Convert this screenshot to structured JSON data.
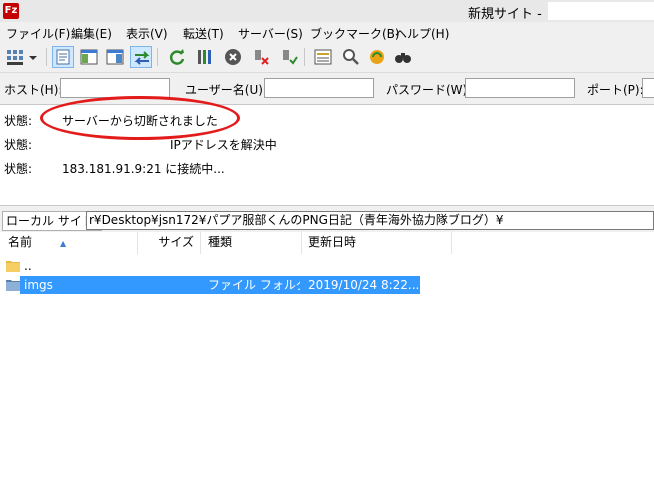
{
  "window": {
    "app_icon_text": "Fz",
    "title": "新規サイト -"
  },
  "menu": [
    "ファイル(F)",
    "編集(E)",
    "表示(V)",
    "転送(T)",
    "サーバー(S)",
    "ブックマーク(B)",
    "ヘルプ(H)"
  ],
  "quickconnect": {
    "host_label": "ホスト(H):",
    "user_label": "ユーザー名(U):",
    "pass_label": "パスワード(W):",
    "port_label": "ポート(P):",
    "host_value": "",
    "user_value": "",
    "pass_value": "",
    "port_value": ""
  },
  "log": {
    "label": "状態:",
    "lines": [
      "サーバーから切断されました",
      "IPアドレスを解決中",
      "183.181.91.9:21 に接続中..."
    ]
  },
  "local_site": {
    "label": "ローカル サイト:",
    "path": "r¥Desktop¥jsn172¥パプア服部くんのPNG日記（青年海外協力隊ブログ）¥"
  },
  "file_list": {
    "columns": [
      "名前",
      "サイズ",
      "種類",
      "更新日時"
    ],
    "rows": [
      {
        "name": "..",
        "size": "",
        "type": "",
        "modified": "",
        "icon": "parent-folder-icon"
      },
      {
        "name": "imgs",
        "size": "",
        "type": "ファイル フォルダー",
        "modified": "2019/10/24 8:22...",
        "icon": "folder-icon"
      }
    ]
  },
  "colors": {
    "selection": "#3399ff",
    "annotation_circle": "#e41b1b",
    "app_icon": "#c40000"
  }
}
